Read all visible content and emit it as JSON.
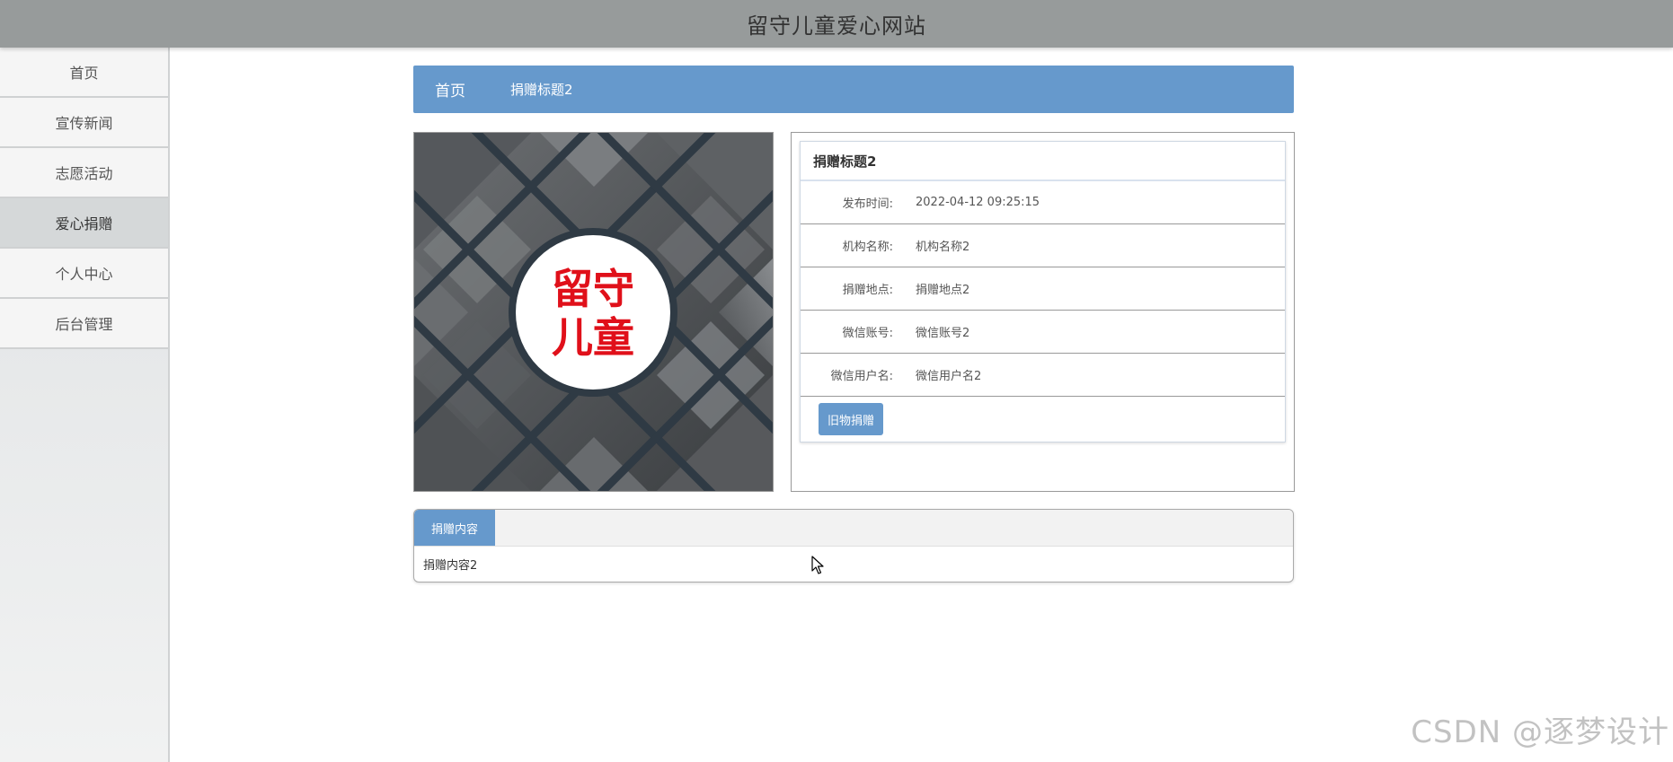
{
  "site": {
    "title": "留守儿童爱心网站"
  },
  "sidebar": {
    "items": [
      {
        "label": "首页"
      },
      {
        "label": "宣传新闻"
      },
      {
        "label": "志愿活动"
      },
      {
        "label": "爱心捐赠"
      },
      {
        "label": "个人中心"
      },
      {
        "label": "后台管理"
      }
    ],
    "active": "爱心捐赠"
  },
  "breadcrumb": {
    "home": "首页",
    "current": "捐赠标题2"
  },
  "image": {
    "logo_line1": "留守",
    "logo_line2": "儿童",
    "logo_color": "#e0101a"
  },
  "detail": {
    "title": "捐赠标题2",
    "fields": [
      {
        "label": "发布时间:",
        "value": "2022-04-12 09:25:15"
      },
      {
        "label": "机构名称:",
        "value": "机构名称2"
      },
      {
        "label": "捐赠地点:",
        "value": "捐赠地点2"
      },
      {
        "label": "微信账号:",
        "value": "微信账号2"
      },
      {
        "label": "微信用户名:",
        "value": "微信用户名2"
      }
    ],
    "button": "旧物捐赠"
  },
  "content_tab": {
    "label": "捐赠内容",
    "body": "捐赠内容2"
  },
  "watermark": "CSDN @逐梦设计",
  "colors": {
    "accent": "#6699cc",
    "header": "#979b9b"
  }
}
